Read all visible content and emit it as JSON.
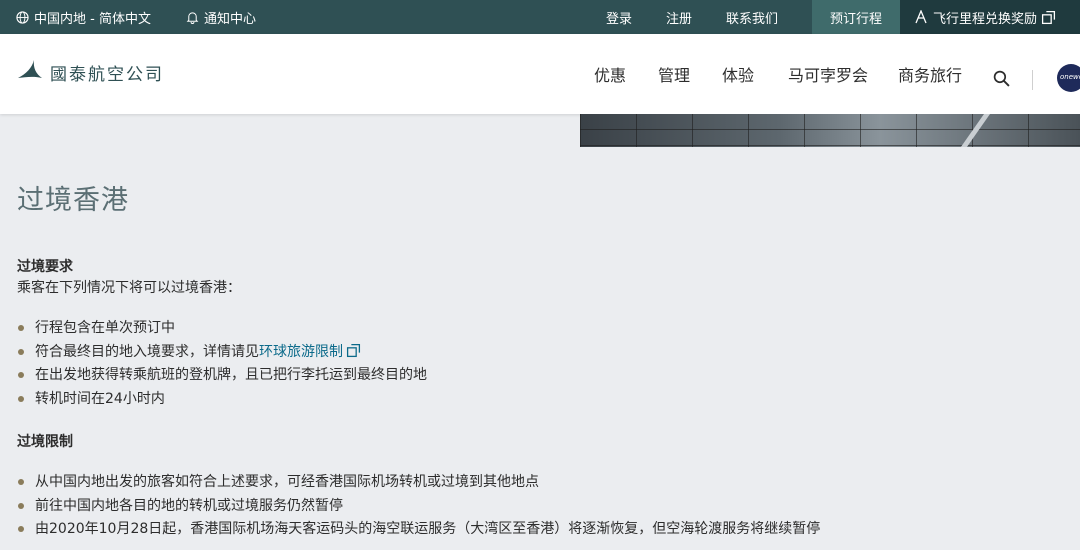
{
  "topbar": {
    "region": "中国内地 - 简体中文",
    "notifications": "通知中心",
    "login": "登录",
    "register": "注册",
    "contact": "联系我们",
    "manage_booking": "预订行程",
    "miles": "飞行里程兑换奖励"
  },
  "header": {
    "logo_text": "國泰航空公司",
    "nav": [
      "优惠",
      "管理",
      "体验",
      "马可孛罗会",
      "商务旅行"
    ],
    "oneworld_label": "oneworld"
  },
  "content": {
    "title": "过境香港",
    "req_heading": "过境要求",
    "req_intro": "乘客在下列情况下将可以过境香港：",
    "req_items": [
      {
        "text": "行程包含在单次预订中"
      },
      {
        "text": "符合最终目的地入境要求，详情请见",
        "link": "环球旅游限制"
      },
      {
        "text": "在出发地获得转乘航班的登机牌，且已把行李托运到最终目的地"
      },
      {
        "text": "转机时间在24小时内"
      }
    ],
    "limit_heading": "过境限制",
    "limit_items": [
      "从中国内地出发的旅客如符合上述要求，可经香港国际机场转机或过境到其他地点",
      "前往中国内地各目的地的转机或过境服务仍然暂停",
      "由2020年10月28日起，香港国际机场海天客运码头的海空联运服务（大湾区至香港）将逐渐恢复，但空海轮渡服务将继续暂停"
    ]
  },
  "colors": {
    "topbar": "#2f5054",
    "accent_link": "#0b6a8a",
    "bullet": "#8a7c5b",
    "title": "#5b6f74",
    "page_bg": "#ebedf0"
  }
}
